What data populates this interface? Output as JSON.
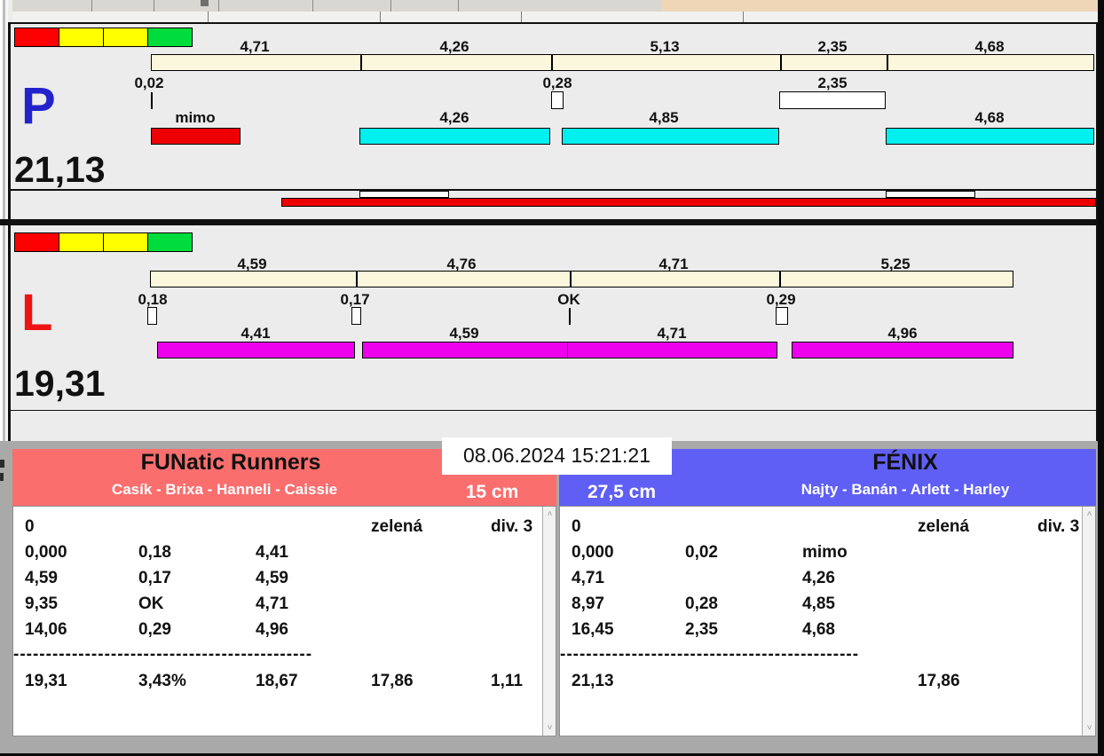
{
  "colors": {
    "legend": [
      "#FF0000",
      "#FFFF00",
      "#FFFF00",
      "#00DC3C"
    ],
    "split_bar": "#FBF7DC",
    "lane_p_runs": "#00EFEF",
    "lane_l_runs": "#EE00EE",
    "fault_bar": "#EE0000",
    "team_left_header": "#FA6E6E",
    "team_right_header": "#5F5FF5",
    "lane_p_letter": "#2323CC",
    "lane_l_letter": "#EE1414"
  },
  "lane_p": {
    "letter": "P",
    "total": "21,13",
    "splits": [
      "4,71",
      "4,26",
      "5,13",
      "2,35",
      "4,68"
    ],
    "faults": [
      "0,02",
      "0,28",
      "2,35"
    ],
    "runs": [
      "mimo",
      "4,26",
      "4,85",
      "4,68"
    ]
  },
  "lane_l": {
    "letter": "L",
    "total": "19,31",
    "splits": [
      "4,59",
      "4,76",
      "4,71",
      "5,25"
    ],
    "faults": [
      "0,18",
      "0,17",
      "OK",
      "0,29"
    ],
    "runs": [
      "4,41",
      "4,59",
      "4,71",
      "4,96"
    ]
  },
  "scoreboard": {
    "datetime": "08.06.2024 15:21:21",
    "left": {
      "team": "FUNatic Runners",
      "members": "Casík - Brixa - Hanneli - Caissie",
      "height": "15 cm",
      "rows": [
        [
          "0",
          "",
          "",
          "zelená",
          "div. 3"
        ],
        [
          "0,000",
          "0,18",
          "4,41",
          "",
          ""
        ],
        [
          "4,59",
          "0,17",
          "4,59",
          "",
          ""
        ],
        [
          "9,35",
          "OK",
          "4,71",
          "",
          ""
        ],
        [
          "14,06",
          "0,29",
          "4,96",
          "",
          ""
        ]
      ],
      "separator": "----------------------------------------------",
      "totals": [
        "19,31",
        "3,43%",
        "18,67",
        "17,86",
        "1,11"
      ]
    },
    "right": {
      "team": "FÉNIX",
      "members": "Najty - Banán - Arlett - Harley",
      "height": "27,5 cm",
      "rows": [
        [
          "0",
          "",
          "",
          "zelená",
          "div. 3"
        ],
        [
          "0,000",
          "0,02",
          "mimo",
          "",
          ""
        ],
        [
          "4,71",
          "",
          "4,26",
          "",
          ""
        ],
        [
          "8,97",
          "0,28",
          "4,85",
          "",
          ""
        ],
        [
          "16,45",
          "2,35",
          "4,68",
          "",
          ""
        ]
      ],
      "separator": "----------------------------------------------",
      "totals": [
        "21,13",
        "",
        "",
        "17,86",
        ""
      ]
    }
  },
  "icons": {
    "scroll_up": "˄",
    "scroll_down": "˅"
  }
}
